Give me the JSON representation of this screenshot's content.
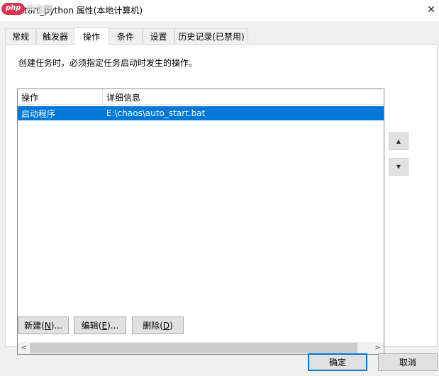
{
  "window": {
    "title": "start_python 属性(本地计算机)",
    "close_glyph": "✕",
    "watermark_php": "php",
    "watermark_cn": "中文网"
  },
  "tabs": [
    {
      "label": "常规",
      "active": false
    },
    {
      "label": "触发器",
      "active": false
    },
    {
      "label": "操作",
      "active": true
    },
    {
      "label": "条件",
      "active": false
    },
    {
      "label": "设置",
      "active": false
    },
    {
      "label": "历史记录(已禁用)",
      "active": false
    }
  ],
  "actions_tab": {
    "description": "创建任务时，必须指定任务启动时发生的操作。",
    "columns": [
      "操作",
      "详细信息"
    ],
    "rows": [
      {
        "action": "启动程序",
        "details": "E:\\chaos\\auto_start.bat",
        "selected": true
      }
    ],
    "scroll_left": "<",
    "scroll_right": ">",
    "move_up_glyph": "▲",
    "move_down_glyph": "▼",
    "new_button": {
      "label": "新建(",
      "accel": "N",
      "suffix": ")..."
    },
    "edit_button": {
      "label": "编辑(",
      "accel": "E",
      "suffix": ")..."
    },
    "delete_button": {
      "label": "删除(",
      "accel": "D",
      "suffix": ")"
    }
  },
  "footer": {
    "ok": "确定",
    "cancel": "取消"
  },
  "colors": {
    "selection": "#0078d7",
    "window_bg": "#f0f0f0",
    "button_bg": "#e1e1e1"
  }
}
